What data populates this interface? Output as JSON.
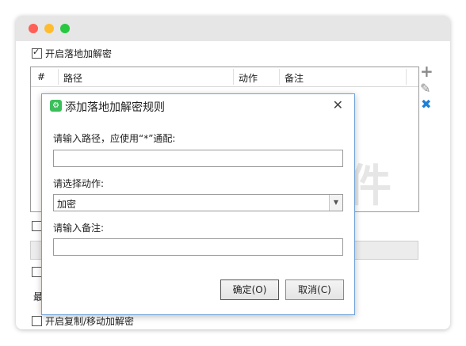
{
  "window": {
    "enable_local_label": "开启落地加解密",
    "enable_copy_label": "开启复制/移动加解密",
    "partial_label": "最"
  },
  "table": {
    "columns": [
      "#",
      "路径",
      "动作",
      "备注"
    ]
  },
  "side_icons": {
    "add": "+",
    "edit": "✎",
    "delete": "✖"
  },
  "watermark": "信企卫软件",
  "dialog": {
    "title": "添加落地加解密规则",
    "close_glyph": "✕",
    "path_prompt": "请输入路径，应使用“*”通配:",
    "path_value": "",
    "action_prompt": "请选择动作:",
    "action_selected": "加密",
    "note_prompt": "请输入备注:",
    "note_value": "",
    "ok_label": "确定(O)",
    "cancel_label": "取消(C)"
  },
  "colors": {
    "add_icon": "#8a8a8a",
    "edit_icon": "#8a8a8a",
    "delete_icon": "#1e7fd6",
    "dialog_border": "#6fa2d6"
  }
}
